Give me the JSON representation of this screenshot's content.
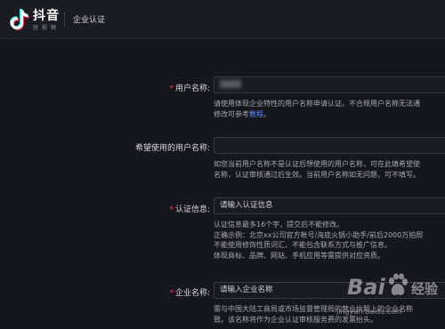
{
  "header": {
    "app_name": "抖音",
    "app_sub": "轻 视 频",
    "page_title": "企业认证"
  },
  "form": {
    "username": {
      "label": "用户名称:",
      "help_line1": "请使用体现企业特性的用户名称申请认证。不合规用户名称无法通",
      "help_line2_prefix": "修改可参考",
      "help_link": "教程",
      "help_line2_suffix": "。"
    },
    "wanted_name": {
      "label": "希望使用的用户名称:",
      "value": "",
      "help_line1": "如您当前用户名称不是认证后想使用的用户名称，可在此填希望使",
      "help_line2": "名称，认证审核通过后生效。当前用户名称如无问题，可不填写。"
    },
    "cert_info": {
      "label": "认证信息:",
      "placeholder": "请输入认证信息",
      "help_lines": [
        "认证信息最多16个字，提交后不能修改。",
        "正确示例：北京xx公司官方帐号/海底火锅小助手/前后2000万拍照",
        "不能使用修饰性质词汇、不能包含联系方式与推广信息。",
        "体现商标、品牌、网站、手机应用等需提供对应资质。"
      ]
    },
    "company_name": {
      "label": "企业名称:",
      "placeholder": "请输入企业名称",
      "help_lines": [
        "需与中国大陆工商局或市场监督管理局的营业执照上的企业名称",
        "致。该名称将作为企业认证审核服务费的发票抬头。"
      ]
    }
  },
  "watermark": {
    "logo": "Bai",
    "text": "经验",
    "url": "jingyan.baidu.com"
  },
  "colors": {
    "background": "#16161d",
    "required": "#fe2c55",
    "link": "#5b8cff"
  }
}
